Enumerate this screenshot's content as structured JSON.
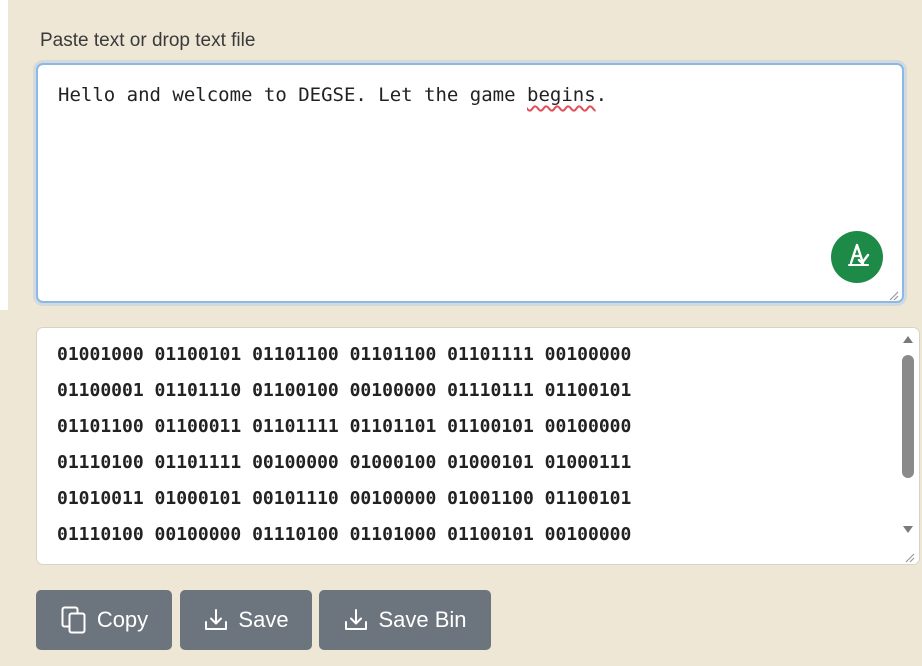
{
  "input": {
    "label": "Paste text or drop text file",
    "text_before": "Hello and welcome to DEGSE. Let the game ",
    "text_misspelled": "begins",
    "text_after": ".",
    "grammar_icon": "grammar-check-icon",
    "resize_icon": "resize-grip-icon"
  },
  "output": {
    "lines": [
      "01001000 01100101 01101100 01101100 01101111 00100000",
      "01100001 01101110 01100100 00100000 01110111 01100101",
      "01101100 01100011 01101111 01101101 01100101 00100000",
      "01110100 01101111 00100000 01000100 01000101 01000111",
      "01010011 01000101 00101110 00100000 01001100 01100101",
      "01110100 00100000 01110100 01101000 01100101 00100000"
    ],
    "scroll_icon_up": "scroll-up-arrow-icon",
    "scroll_icon_down": "scroll-down-arrow-icon"
  },
  "buttons": {
    "copy_label": "Copy",
    "copy_icon": "copy-icon",
    "save_label": "Save",
    "save_icon": "download-icon",
    "save_bin_label": "Save Bin",
    "save_bin_icon": "download-icon"
  },
  "colors": {
    "panel_background": "#efe7d6",
    "input_border_focus": "#8ab8e8",
    "grammar_button": "#1e8a47",
    "button_background": "#6c757d",
    "spellcheck_underline": "#e0505a"
  }
}
